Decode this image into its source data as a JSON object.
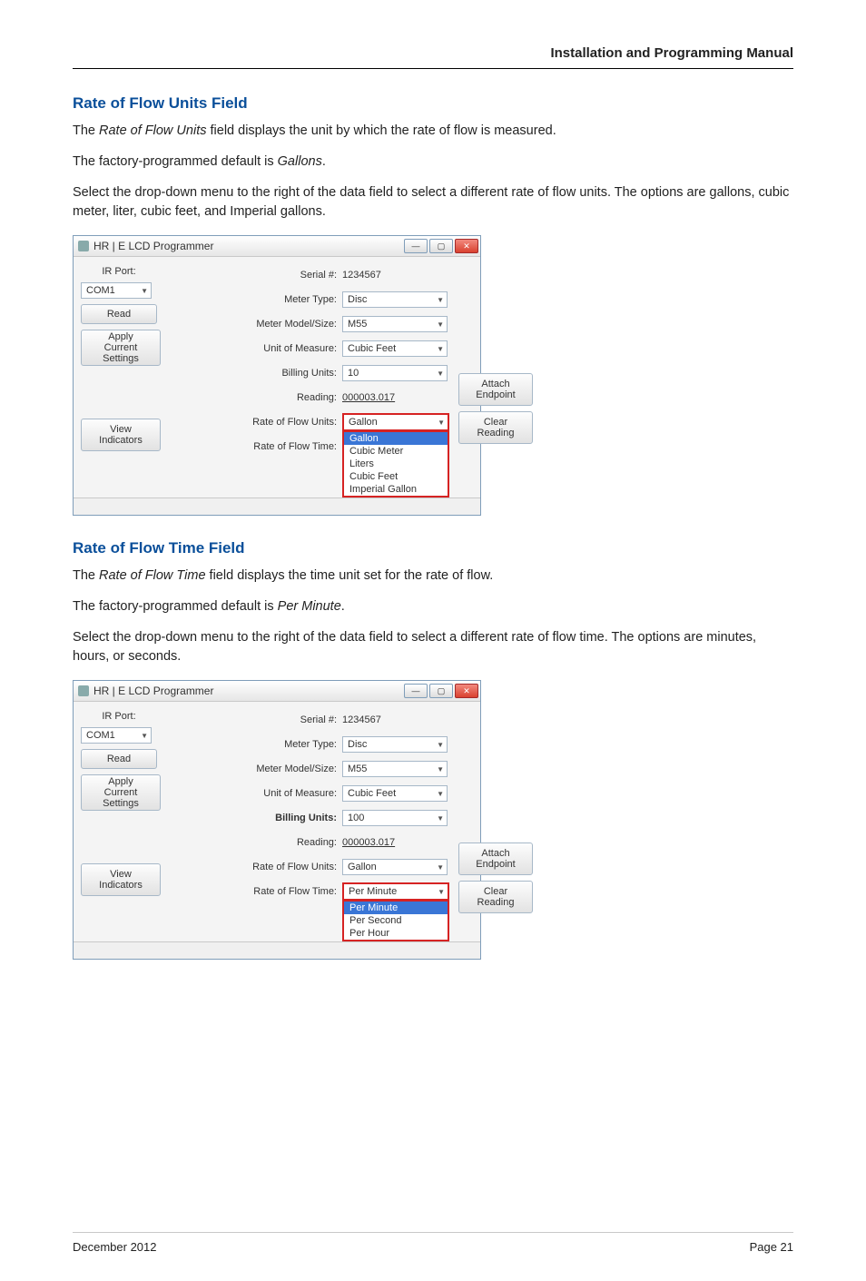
{
  "page_header": "Installation and Programming Manual",
  "footer": {
    "left": "December 2012",
    "right": "Page 21"
  },
  "section1": {
    "heading": "Rate of Flow Units Field",
    "p1a": "The ",
    "p1b": "Rate of Flow Units",
    "p1c": " field displays the unit by which the rate of flow is measured.",
    "p2a": "The factory-programmed default is ",
    "p2b": "Gallons",
    "p2c": ".",
    "p3": "Select the drop-down menu to the right of the data field to select a different rate of flow units. The options are gallons, cubic meter, liter, cubic feet, and Imperial gallons."
  },
  "section2": {
    "heading": "Rate of Flow Time Field",
    "p1a": "The ",
    "p1b": "Rate of Flow Time",
    "p1c": " field displays the time unit set for the rate of flow.",
    "p2a": "The factory-programmed default is ",
    "p2b": "Per Minute",
    "p2c": ".",
    "p3": "Select the drop-down menu to the right of the data field to select a different rate of flow time. The options are minutes, hours, or seconds."
  },
  "app_common": {
    "title": "HR | E LCD Programmer",
    "ir_port_label": "IR Port:",
    "ir_port_value": "COM1",
    "read_btn": "Read",
    "apply_line1": "Apply",
    "apply_line2": "Current",
    "apply_line3": "Settings",
    "view_line1": "View",
    "view_line2": "Indicators",
    "serial_label": "Serial #:",
    "serial_value": "1234567",
    "meter_type_label": "Meter Type:",
    "meter_model_label": "Meter Model/Size:",
    "unit_measure_label": "Unit of Measure:",
    "billing_units_label": "Billing Units:",
    "reading_label": "Reading:",
    "reading_value": "000003.017",
    "rof_units_label": "Rate of Flow Units:",
    "rof_time_label": "Rate of Flow Time:",
    "attach_line1": "Attach",
    "attach_line2": "Endpoint",
    "clear_line1": "Clear",
    "clear_line2": "Reading",
    "meter_type_value": "Disc",
    "meter_model_value": "M55",
    "unit_measure_value": "Cubic Feet"
  },
  "screenshot1": {
    "billing_units_value": "10",
    "rof_units_value": "Gallon",
    "dropdown_items": [
      "Gallon",
      "Cubic Meter",
      "Liters",
      "Cubic Feet",
      "Imperial Gallon"
    ]
  },
  "screenshot2": {
    "billing_units_value": "100",
    "rof_units_value": "Gallon",
    "rof_time_value": "Per Minute",
    "dropdown_items": [
      "Per Minute",
      "Per Second",
      "Per Hour"
    ]
  }
}
